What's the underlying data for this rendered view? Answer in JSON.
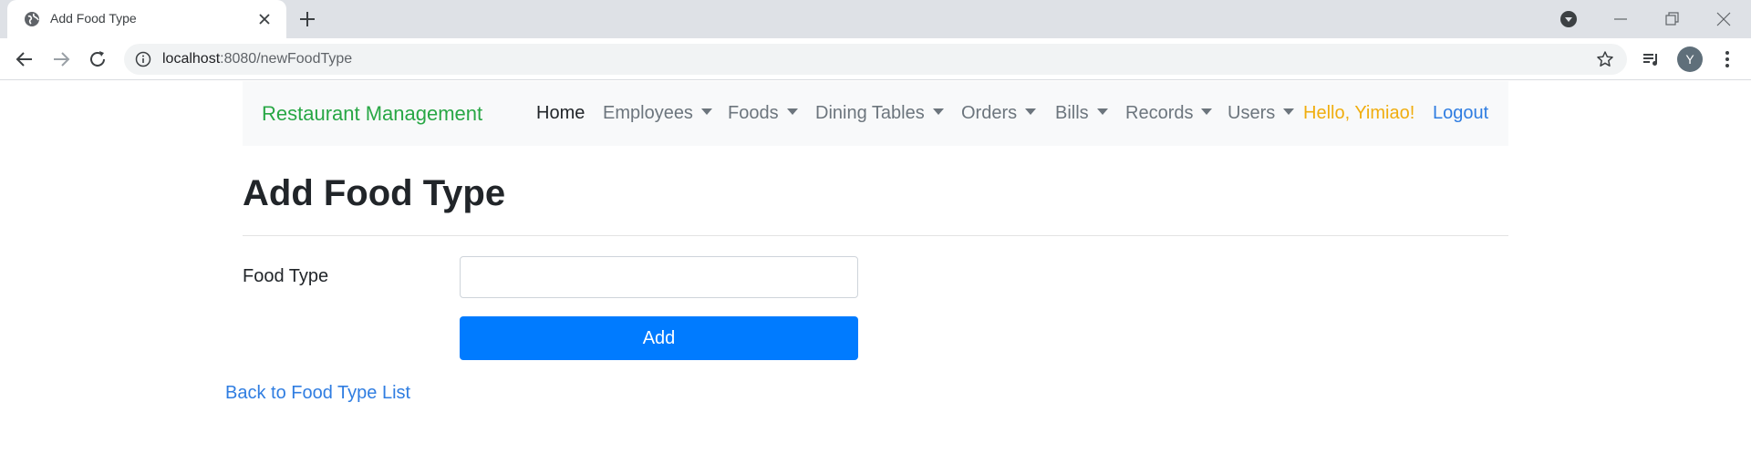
{
  "browser": {
    "tab_title": "Add Food Type",
    "url_host": "localhost",
    "url_path": ":8080/newFoodType",
    "avatar_letter": "Y",
    "icons": [
      "globe-icon",
      "close-icon",
      "plus-icon",
      "media-icon",
      "minimize-icon",
      "restore-icon",
      "window-close-icon",
      "back-icon",
      "forward-icon",
      "reload-icon",
      "info-icon",
      "star-icon",
      "playlist-icon",
      "more-icon"
    ]
  },
  "navbar": {
    "brand": "Restaurant Management",
    "items": [
      {
        "label": "Home",
        "dropdown": false,
        "active": true
      },
      {
        "label": "Employees",
        "dropdown": true
      },
      {
        "label": "Foods",
        "dropdown": true
      },
      {
        "label": "Dining Tables",
        "dropdown": true
      },
      {
        "label": "Orders",
        "dropdown": true
      },
      {
        "label": "Bills",
        "dropdown": true
      },
      {
        "label": "Records",
        "dropdown": true
      },
      {
        "label": "Users",
        "dropdown": true
      }
    ],
    "greeting": "Hello, Yimiao!",
    "logout": "Logout"
  },
  "page": {
    "title": "Add Food Type",
    "field_label": "Food Type",
    "field_value": "",
    "submit_label": "Add",
    "back_link": "Back to Food Type List"
  },
  "colors": {
    "brand": "#28a745",
    "greeting": "#f0ad0e",
    "link": "#2f7de1",
    "primary_button": "#007bff",
    "navbar_bg": "#f8f9fa"
  }
}
